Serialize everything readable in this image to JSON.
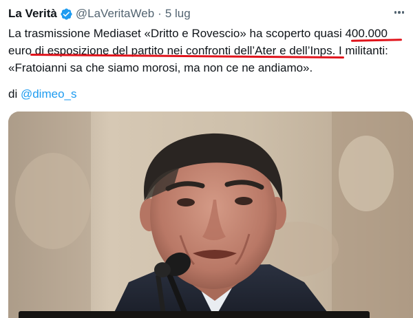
{
  "tweet": {
    "display_name": "La Verità",
    "handle": "@LaVeritaWeb",
    "separator": "·",
    "date": "5 lug",
    "body_lines": [
      "La trasmissione Mediaset «Dritto e Rovescio» ha scoperto quasi 400.000",
      "euro di esposizione del partito nei confronti dell’Ater e dell’Inps. I militanti:",
      "«Fratoianni sa che siamo morosi, ma non ce ne andiamo»."
    ],
    "byline_prefix": "di",
    "byline_mention": "@dimeo_s"
  },
  "icons": {
    "verified": "verified-badge-icon",
    "more": "more-options-icon"
  },
  "colors": {
    "text": "#0f1419",
    "secondary": "#536471",
    "link": "#1d9bf0",
    "verified": "#1d9bf0",
    "annotation": "#e0131b"
  }
}
